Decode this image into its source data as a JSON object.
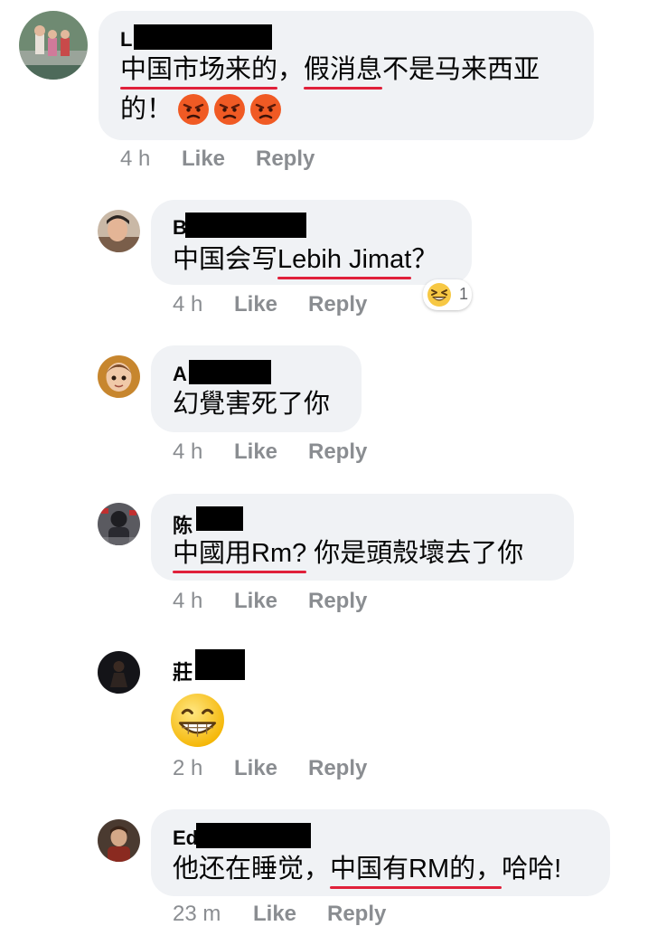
{
  "comments": [
    {
      "name": "L",
      "text_parts": [
        "中国市场来的",
        "，",
        "假消息",
        "不是马来西亚"
      ],
      "line2": "的！",
      "reaction_icons": [
        "angry-face-icon",
        "angry-face-icon",
        "angry-face-icon"
      ],
      "time": "4 h",
      "like": "Like",
      "reply": "Reply"
    },
    {
      "name": "B",
      "text_parts": [
        "中国会写",
        "Lebih Jimat",
        "？"
      ],
      "reaction": {
        "icon": "laughing-face-icon",
        "count": "1"
      },
      "time": "4 h",
      "like": "Like",
      "reply": "Reply"
    },
    {
      "name": "A",
      "text": "幻覺害死了你",
      "time": "4 h",
      "like": "Like",
      "reply": "Reply"
    },
    {
      "name": "陈",
      "text_parts": [
        "中國用Rm?",
        " 你是頭殼壞去了你"
      ],
      "time": "4 h",
      "like": "Like",
      "reply": "Reply"
    },
    {
      "name": "莊",
      "sticker": "grinning-face-icon",
      "time": "2 h",
      "like": "Like",
      "reply": "Reply"
    },
    {
      "name": "Ed",
      "text_parts": [
        "他还在睡觉，",
        "中国有RM的，",
        "哈哈!"
      ],
      "time": "23 m",
      "like": "Like",
      "reply": "Reply"
    }
  ],
  "colors": {
    "bubble": "#f0f2f5",
    "underline": "#e0203a",
    "meta": "#8a8d91",
    "emoji_angry": "#f05a24",
    "emoji_yellow": "#f7c844"
  }
}
